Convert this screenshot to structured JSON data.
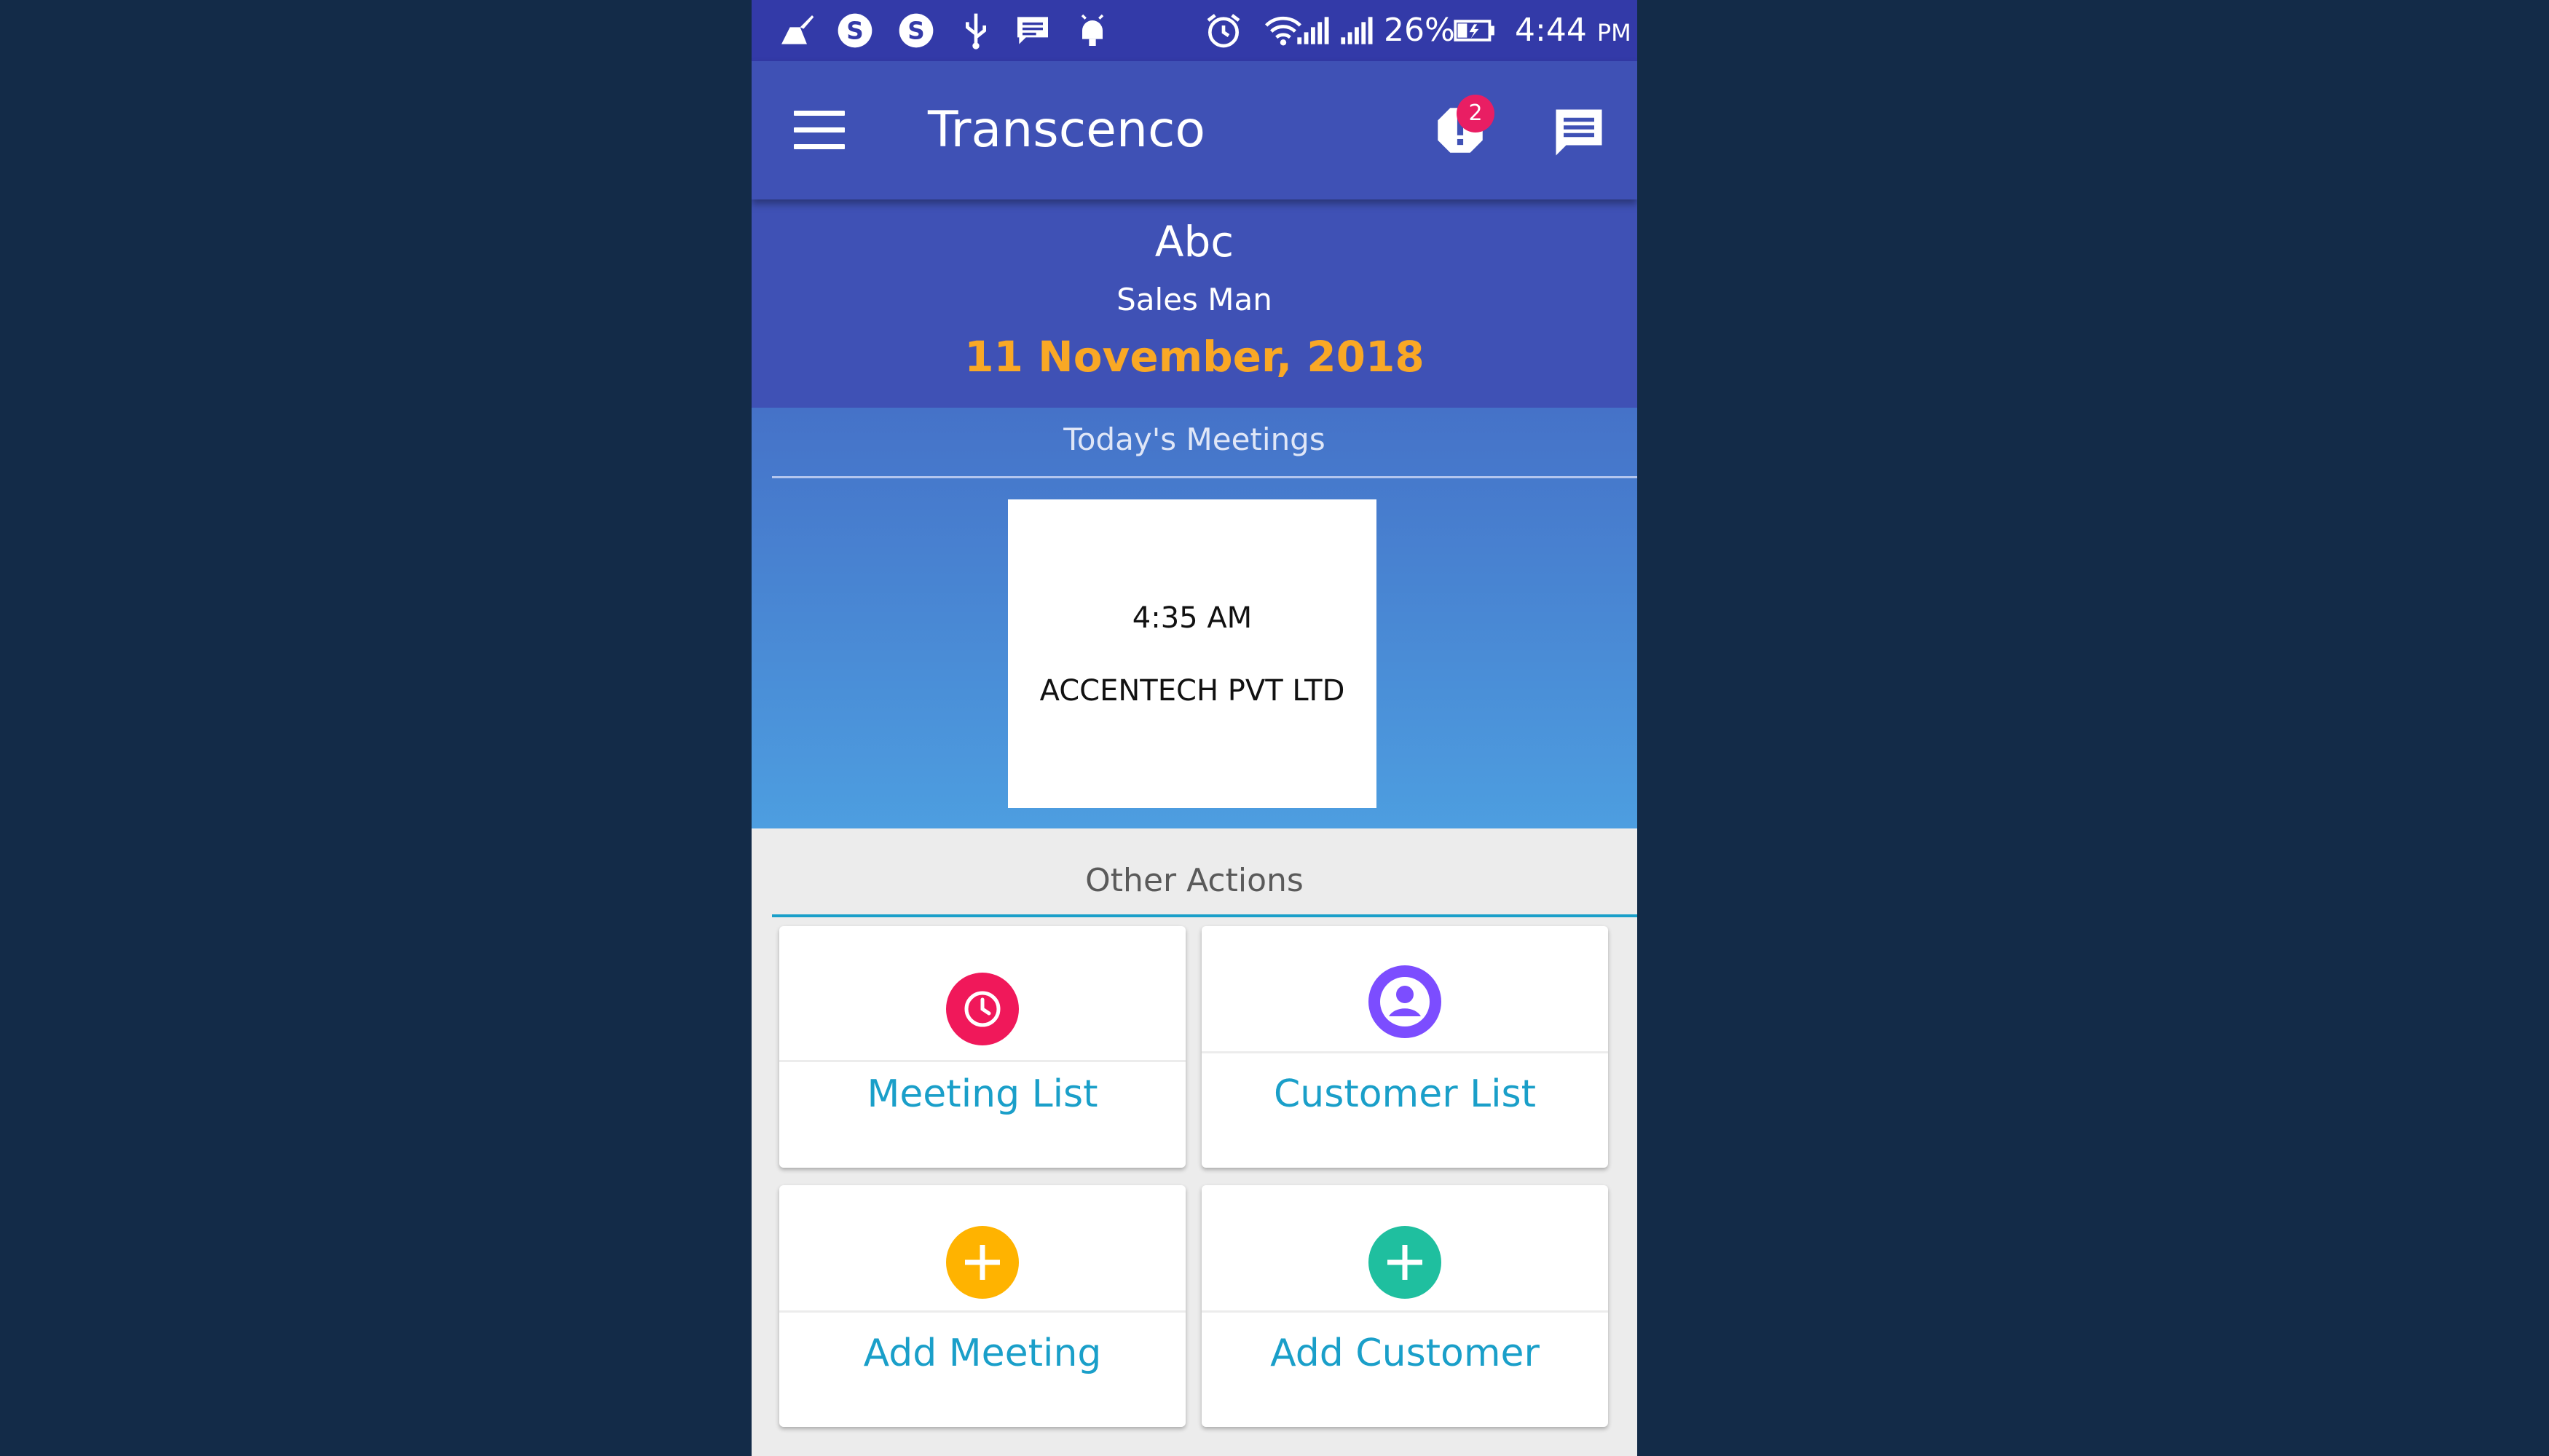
{
  "status_bar": {
    "battery": "26%",
    "time": "4:44",
    "ampm": "PM",
    "icons": [
      "cleaner-icon",
      "skype-icon",
      "skype-icon",
      "usb-icon",
      "message-icon",
      "android-icon",
      "alarm-icon",
      "wifi-icon",
      "signal-icon",
      "signal-icon",
      "battery-icon"
    ]
  },
  "app_bar": {
    "title": "Transcenco",
    "notification_count": "2"
  },
  "profile": {
    "name": "Abc",
    "role": "Sales Man",
    "date": "11 November, 2018"
  },
  "meetings": {
    "section_title": "Today's Meetings",
    "items": [
      {
        "time": "4:35 AM",
        "company": "ACCENTECH PVT LTD"
      }
    ]
  },
  "actions": {
    "section_title": "Other Actions",
    "tiles": [
      {
        "label": "Meeting List",
        "icon": "clock-icon",
        "color": "#f0185a"
      },
      {
        "label": "Customer List",
        "icon": "user-circle-icon",
        "color": "#7c4dff"
      },
      {
        "label": "Add Meeting",
        "icon": "plus-icon",
        "color": "#ffb300"
      },
      {
        "label": "Add Customer",
        "icon": "plus-icon",
        "color": "#1fbf9f"
      }
    ]
  },
  "colors": {
    "background": "#132b48",
    "status_bar": "#333aa8",
    "primary": "#3f51b5",
    "date_accent": "#f9a825",
    "link": "#1a9fc9",
    "badge": "#e91e63"
  }
}
